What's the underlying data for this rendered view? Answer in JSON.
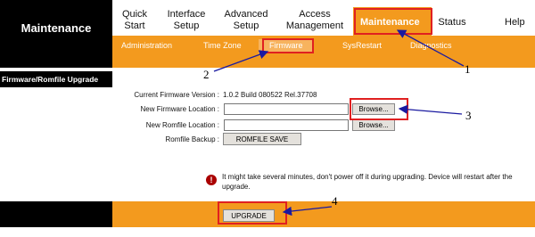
{
  "left": {
    "title": "Maintenance",
    "sidebar_item": "Firmware/Romfile Upgrade"
  },
  "nav": {
    "quick_start": "Quick Start",
    "interface_setup": "Interface Setup",
    "advanced_setup": "Advanced Setup",
    "access_management": "Access Management",
    "maintenance": "Maintenance",
    "status": "Status",
    "help": "Help"
  },
  "subnav": {
    "administration": "Administration",
    "time_zone": "Time Zone",
    "firmware": "Firmware",
    "sysrestart": "SysRestart",
    "diagnostics": "Diagnostics"
  },
  "form": {
    "current_firmware_label": "Current Firmware Version :",
    "current_firmware_value": "1.0.2 Build 080522 Rel.37708",
    "new_firmware_label": "New Firmware Location :",
    "new_firmware_value": "",
    "new_romfile_label": "New Romfile Location :",
    "new_romfile_value": "",
    "browse_label": "Browse...",
    "romfile_backup_label": "Romfile Backup :",
    "romfile_save_label": "ROMFILE SAVE"
  },
  "note": "It might take several minutes, don't power off it during upgrading. Device will restart after the upgrade.",
  "footer": {
    "upgrade_label": "UPGRADE"
  },
  "annotations": [
    "1",
    "2",
    "3",
    "4"
  ],
  "colors": {
    "accent": "#f39a1e",
    "annotation": "#e02020",
    "arrow": "#1a1aa0"
  }
}
